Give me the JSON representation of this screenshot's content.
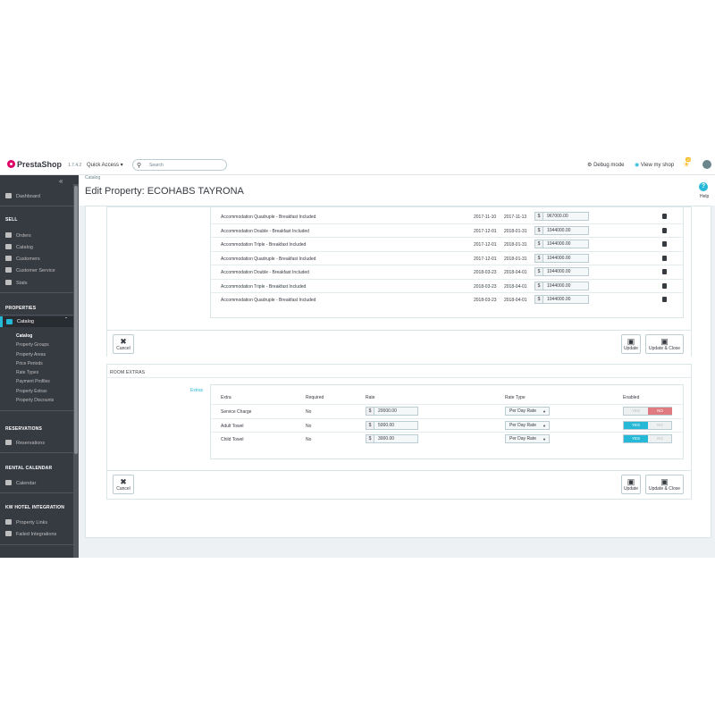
{
  "topbar": {
    "brand": "PrestaShop",
    "version": "1.7.4.2",
    "quick_access": "Quick Access ▾",
    "search_placeholder": "Search",
    "debug_mode": "Debug mode",
    "view_shop": "View my shop",
    "notif_count": "10"
  },
  "sidebar": {
    "dashboard": "Dashboard",
    "sell_title": "SELL",
    "sell_items": [
      "Orders",
      "Catalog",
      "Customers",
      "Customer Service",
      "Stats"
    ],
    "properties_title": "PROPERTIES",
    "catalog_active": "Catalog",
    "catalog_sub": [
      "Catalog",
      "Property Groups",
      "Property Areas",
      "Price Periods",
      "Rate Types",
      "Payment Profiles",
      "Property Extras",
      "Property Discounts"
    ],
    "reservations_title": "RESERVATIONS",
    "reservations_item": "Reservations",
    "rental_title": "RENTAL CALENDAR",
    "calendar_item": "Calendar",
    "kw_title": "KW HOTEL INTEGRATION",
    "kw_items": [
      "Property Links",
      "Failed Integrations"
    ]
  },
  "header": {
    "breadcrumb": "Catalog",
    "title": "Edit Property: ECOHABS TAYRONA",
    "help": "Help"
  },
  "rates": {
    "currency": "$",
    "rows": [
      {
        "name": "Accommodation Quadruple - Breakfast Included",
        "from": "2017-11-10",
        "to": "2017-11-13",
        "amount": "967000.00"
      },
      {
        "name": "Accommodation Double - Breakfast Included",
        "from": "2017-12-01",
        "to": "2018-01-31",
        "amount": "1044000.00"
      },
      {
        "name": "Accommodation Triple - Breakfast Included",
        "from": "2017-12-01",
        "to": "2018-01-31",
        "amount": "1044000.00"
      },
      {
        "name": "Accommodation Quadruple - Breakfast Included",
        "from": "2017-12-01",
        "to": "2018-01-31",
        "amount": "1044000.00"
      },
      {
        "name": "Accommodation Double - Breakfast Included",
        "from": "2018-03-23",
        "to": "2018-04-01",
        "amount": "1044000.00"
      },
      {
        "name": "Accommodation Triple - Breakfast Included",
        "from": "2018-03-23",
        "to": "2018-04-01",
        "amount": "1044000.00"
      },
      {
        "name": "Accommodation Quadruple - Breakfast Included",
        "from": "2018-03-23",
        "to": "2018-04-01",
        "amount": "1044000.00"
      }
    ]
  },
  "actions": {
    "cancel": "Cancel",
    "update": "Update",
    "update_close": "Update & Close"
  },
  "extras": {
    "section_title": "ROOM EXTRAS",
    "tag": "Extras",
    "headers": {
      "extra": "Extra",
      "required": "Required",
      "rate": "Rate",
      "rate_type": "Rate Type",
      "enabled": "Enabled"
    },
    "yes": "YES",
    "no": "NO",
    "rows": [
      {
        "extra": "Service Charge",
        "required": "No",
        "rate": "20000.00",
        "rate_type": "Per Day Rate",
        "enabled": false
      },
      {
        "extra": "Adult Towel",
        "required": "No",
        "rate": "5000.00",
        "rate_type": "Per Day Rate",
        "enabled": true
      },
      {
        "extra": "Child Towel",
        "required": "No",
        "rate": "3000.00",
        "rate_type": "Per Day Rate",
        "enabled": true
      }
    ]
  }
}
